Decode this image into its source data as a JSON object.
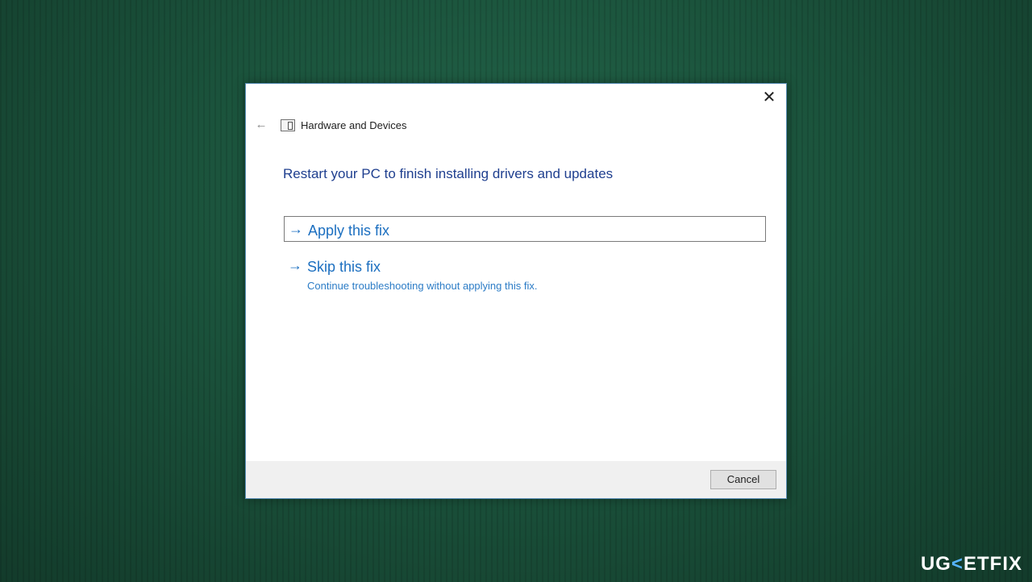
{
  "dialog": {
    "title": "Hardware and Devices",
    "close_glyph": "✕",
    "back_glyph": "←",
    "heading": "Restart your PC to finish installing drivers and updates",
    "options": [
      {
        "label": "Apply this fix"
      },
      {
        "label": "Skip this fix",
        "description": "Continue troubleshooting without applying this fix."
      }
    ],
    "cancel_label": "Cancel"
  },
  "watermark": {
    "part1": "UG",
    "part2": "ETFIX"
  },
  "icons": {
    "back": "back-arrow-icon",
    "close": "close-icon",
    "title": "hardware-devices-icon",
    "option": "arrow-right-icon"
  },
  "colors": {
    "link_blue": "#1c6fc0",
    "heading_blue": "#1f3f8f",
    "background_green": "#1b533c",
    "footer_gray": "#f0f0f0"
  }
}
